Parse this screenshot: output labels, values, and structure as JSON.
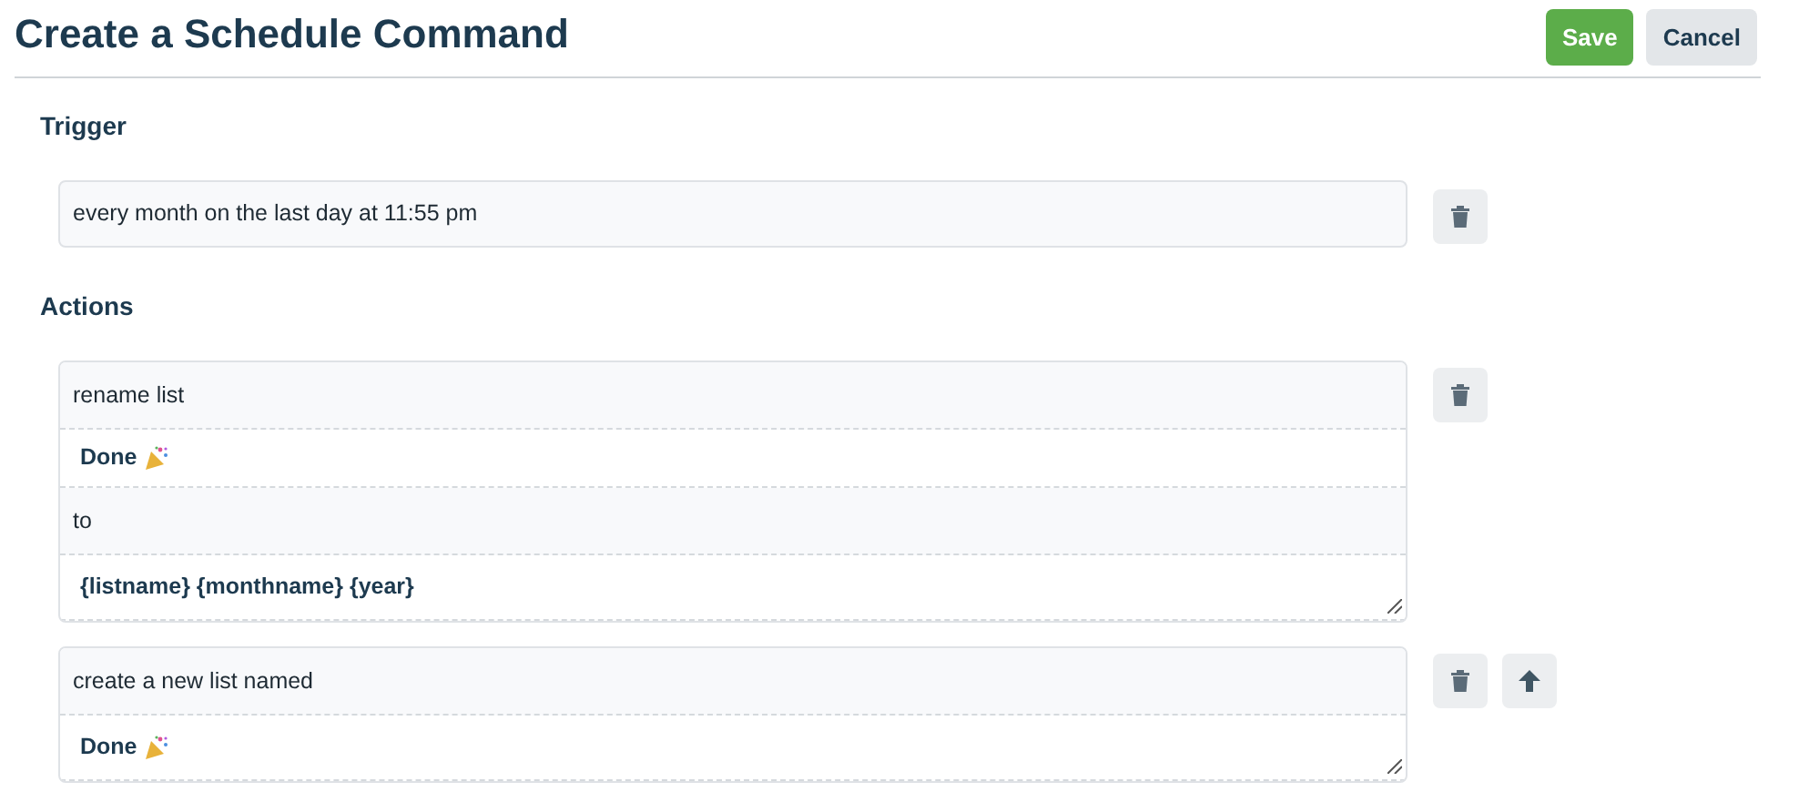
{
  "title": "Create a Schedule Command",
  "header_buttons": [
    {
      "kind": "primary",
      "label": "Save"
    },
    {
      "kind": "secondary",
      "label": "Cancel"
    }
  ],
  "trigger": {
    "heading": "Trigger",
    "value": "every month on the last day at 11:55 pm",
    "tools": [
      {
        "kind": "delete"
      }
    ]
  },
  "actions": {
    "heading": "Actions",
    "items": [
      {
        "parts": [
          {
            "kind": "label",
            "text": "rename list"
          },
          {
            "kind": "value",
            "text": "Done",
            "party_icon": true
          },
          {
            "kind": "label",
            "text": "to"
          },
          {
            "kind": "value",
            "text": "{listname} {monthname} {year}",
            "party_icon": false
          }
        ],
        "tools": [
          {
            "kind": "delete"
          }
        ]
      },
      {
        "parts": [
          {
            "kind": "label",
            "text": "create a new list named"
          },
          {
            "kind": "value",
            "text": "Done",
            "party_icon": true
          }
        ],
        "tools": [
          {
            "kind": "delete"
          },
          {
            "kind": "move_up"
          }
        ]
      }
    ]
  }
}
